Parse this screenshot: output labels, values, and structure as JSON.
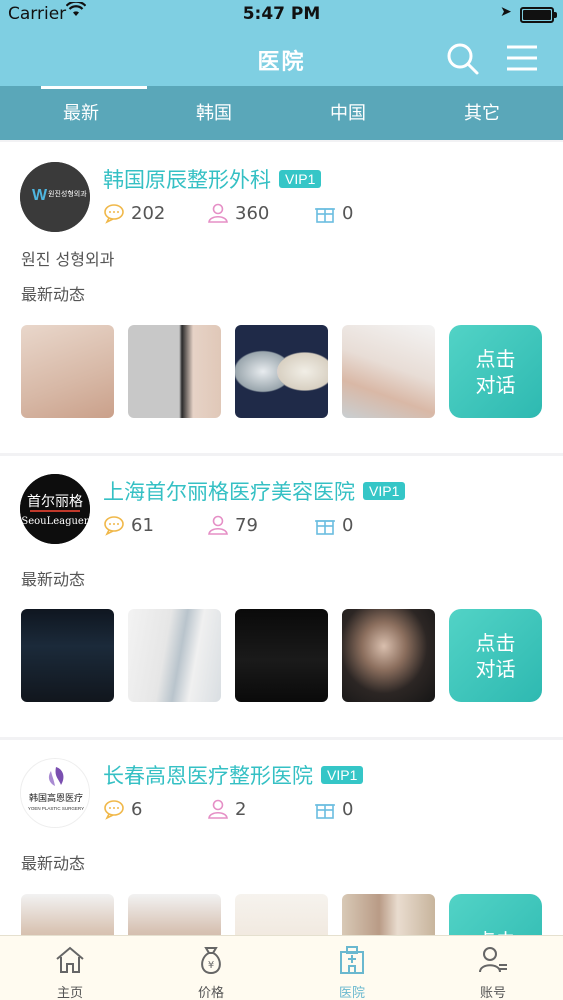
{
  "status_bar": {
    "carrier": "Carrier",
    "time": "5:47 PM",
    "battery_level": 1.0
  },
  "navbar": {
    "title": "医院"
  },
  "tabs": [
    {
      "label": "最新",
      "active": true
    },
    {
      "label": "韩国",
      "active": false
    },
    {
      "label": "中国",
      "active": false
    },
    {
      "label": "其它",
      "active": false
    }
  ],
  "hospitals": [
    {
      "name": "韩国原辰整形外科",
      "vip": "VIP1",
      "comments": "202",
      "followers": "360",
      "gifts": "0",
      "subtitle": "원진 성형외과",
      "section": "最新动态",
      "chat": "点击\n对话",
      "logo_text": "원진성형외과"
    },
    {
      "name": "上海首尔丽格医疗美容医院",
      "vip": "VIP1",
      "comments": "61",
      "followers": "79",
      "gifts": "0",
      "subtitle": "",
      "section": "最新动态",
      "chat": "点击\n对话",
      "logo_text": "首尔丽格",
      "logo_subtext": "SeouLeaguer"
    },
    {
      "name": "长春高恩医疗整形医院",
      "vip": "VIP1",
      "comments": "6",
      "followers": "2",
      "gifts": "0",
      "subtitle": "",
      "section": "最新动态",
      "chat": "点击",
      "logo_text": "韩国高恩医疗",
      "logo_subtext": "YOEN PLASTIC SURGERY"
    }
  ],
  "tabbar": [
    {
      "label": "主页",
      "icon": "home-icon",
      "active": false
    },
    {
      "label": "价格",
      "icon": "money-bag-icon",
      "active": false
    },
    {
      "label": "医院",
      "icon": "hospital-icon",
      "active": true
    },
    {
      "label": "账号",
      "icon": "account-icon",
      "active": false
    }
  ],
  "colors": {
    "accent": "#35c0c4",
    "navbar": "#7fcfe2",
    "tabs": "#5aa7b9",
    "chat_button": "#3cc2b8"
  }
}
